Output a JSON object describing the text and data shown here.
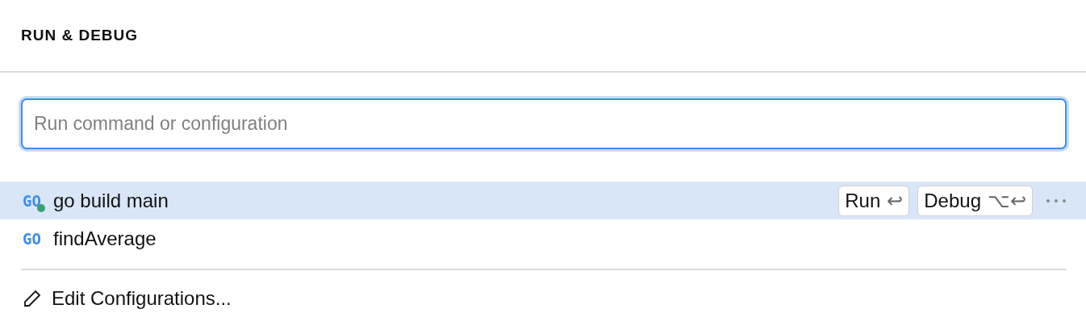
{
  "title": "RUN & DEBUG",
  "search": {
    "placeholder": "Run command or configuration"
  },
  "configurations": [
    {
      "logo": "GO",
      "name": "go build main",
      "selected": true,
      "running": true,
      "actions": [
        {
          "label": "Run",
          "shortcut": "↩"
        },
        {
          "label": "Debug",
          "shortcut": "⌥↩"
        }
      ]
    },
    {
      "logo": "GO",
      "name": "findAverage",
      "selected": false,
      "running": false
    }
  ],
  "footer": {
    "label": "Edit Configurations..."
  }
}
